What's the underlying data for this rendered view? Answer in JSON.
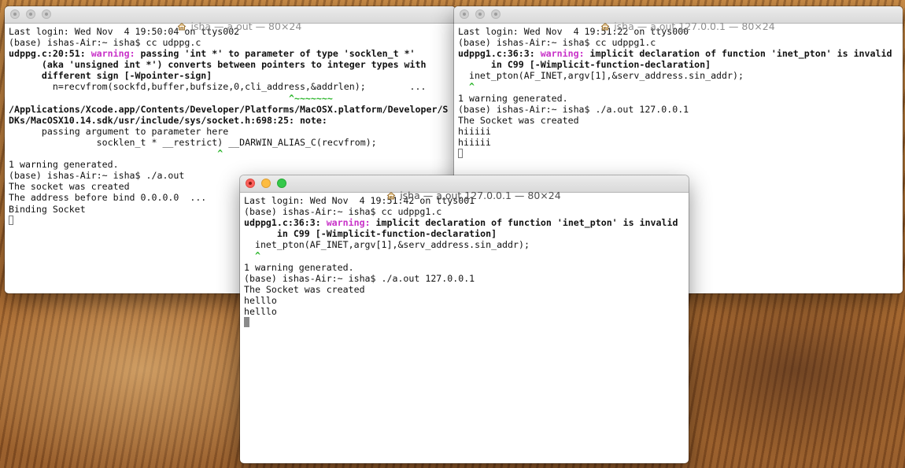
{
  "windows": [
    {
      "id": "left",
      "title": "isha — a.out — 80×24",
      "lines": [
        "Last login: Wed Nov  4 19:50:04 on ttys002",
        "(base) ishas-Air:~ isha$ cc udppg.c",
        "udppg.c:20:51: warning: passing 'int *' to parameter of type 'socklen_t *'",
        "      (aka 'unsigned int *') converts between pointers to integer types with",
        "      different sign [-Wpointer-sign]",
        "        n=recvfrom(sockfd,buffer,bufsize,0,cli_address,&addrlen);        ...",
        "                                                   ^~~~~~~~",
        "/Applications/Xcode.app/Contents/Developer/Platforms/MacOSX.platform/Developer/S",
        "DKs/MacOSX10.14.sdk/usr/include/sys/socket.h:698:25: note:",
        "      passing argument to parameter here",
        "                socklen_t * __restrict) __DARWIN_ALIAS_C(recvfrom);",
        "                                      ^",
        "1 warning generated.",
        "(base) ishas-Air:~ isha$ ./a.out",
        "The socket was created",
        "The address before bind 0.0.0.0  ...",
        "Binding Socket"
      ]
    },
    {
      "id": "right",
      "title": "isha — a.out 127.0.0.1 — 80×24",
      "lines": [
        "Last login: Wed Nov  4 19:51:22 on ttys000",
        "(base) ishas-Air:~ isha$ cc udppg1.c",
        "udppg1.c:36:3: warning: implicit declaration of function 'inet_pton' is invalid",
        "      in C99 [-Wimplicit-function-declaration]",
        "  inet_pton(AF_INET,argv[1],&serv_address.sin_addr);",
        "  ^",
        "1 warning generated.",
        "(base) ishas-Air:~ isha$ ./a.out 127.0.0.1",
        "The Socket was created",
        "hiiiii",
        "hiiiii"
      ]
    },
    {
      "id": "front",
      "title": "isha — a.out 127.0.0.1 — 80×24",
      "lines": [
        "Last login: Wed Nov  4 19:51:42 on ttys001",
        "(base) ishas-Air:~ isha$ cc udppg1.c",
        "udppg1.c:36:3: warning: implicit declaration of function 'inet_pton' is invalid",
        "      in C99 [-Wimplicit-function-declaration]",
        "  inet_pton(AF_INET,argv[1],&serv_address.sin_addr);",
        "  ^",
        "1 warning generated.",
        "(base) ishas-Air:~ isha$ ./a.out 127.0.0.1",
        "The Socket was created",
        "helllo",
        "helllo"
      ]
    }
  ],
  "colors": {
    "warning": "#c831c8",
    "caret": "#2ab52a",
    "close": "#fc605c",
    "minimize": "#fdbc40",
    "maximize": "#34c84a"
  }
}
